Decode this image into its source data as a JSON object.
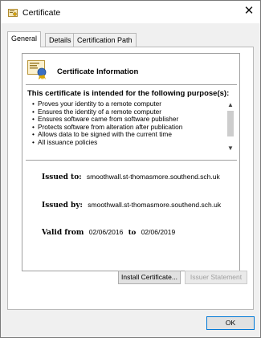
{
  "window": {
    "title": "Certificate",
    "close_glyph": "✕"
  },
  "tabs": [
    {
      "label": "General",
      "active": true
    },
    {
      "label": "Details",
      "active": false
    },
    {
      "label": "Certification Path",
      "active": false
    }
  ],
  "info": {
    "title": "Certificate Information",
    "purpose_heading": "This certificate is intended for the following purpose(s):",
    "purposes": [
      "Proves your identity to a remote computer",
      "Ensures the identity of a remote computer",
      "Ensures software came from software publisher",
      "Protects software from alteration after publication",
      "Allows data to be signed with the current time",
      "All issuance policies"
    ],
    "issued_to_label": "Issued to:",
    "issued_to": "smoothwall.st-thomasmore.southend.sch.uk",
    "issued_by_label": "Issued by:",
    "issued_by": "smoothwall.st-thomasmore.southend.sch.uk",
    "valid_from_label": "Valid from",
    "valid_from": "02/06/2016",
    "valid_to_label": "to",
    "valid_to": "02/06/2019"
  },
  "buttons": {
    "install": "Install Certificate...",
    "issuer": "Issuer Statement",
    "ok": "OK"
  },
  "icons": {
    "title": "certificate-icon",
    "cert": "certificate-icon",
    "scroll_up": "scroll-up-icon",
    "scroll_down": "scroll-down-icon"
  },
  "colors": {
    "accent": "#0078d7",
    "dialog_bg": "#f0f0f0",
    "panel_bg": "#ffffff"
  }
}
